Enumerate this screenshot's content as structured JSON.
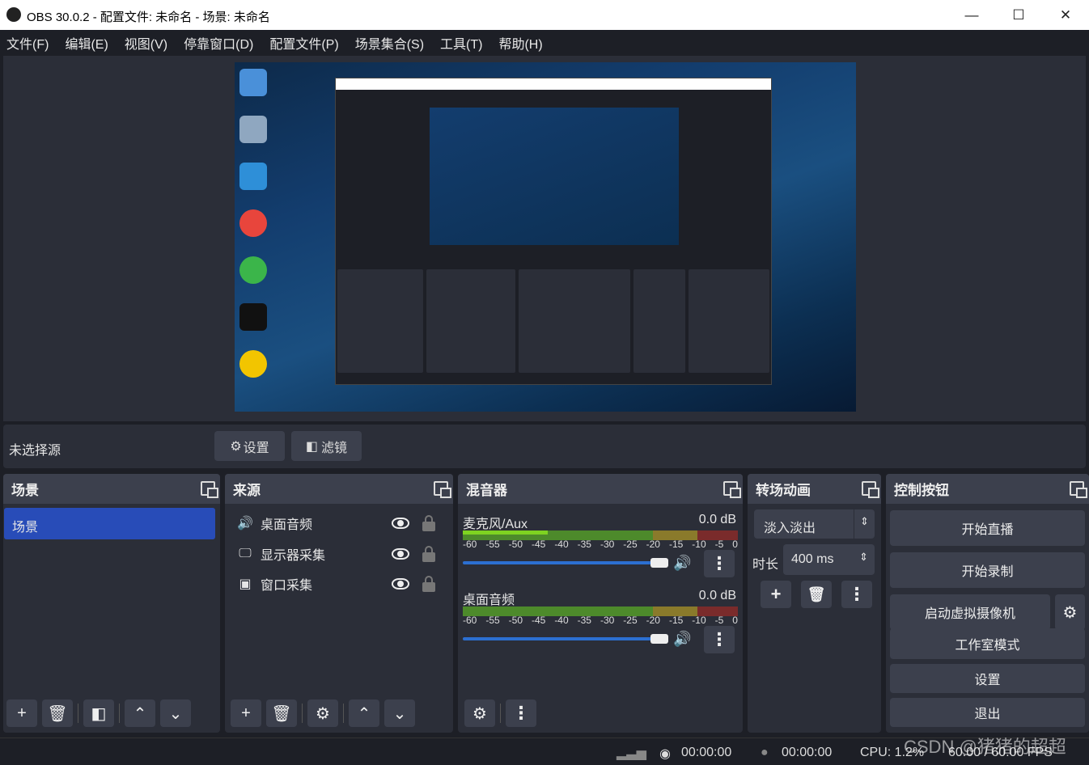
{
  "window": {
    "title": "OBS 30.0.2 - 配置文件: 未命名 - 场景: 未命名",
    "minimize": "—",
    "maximize": "☐",
    "close": "✕"
  },
  "menu": [
    "文件(F)",
    "编辑(E)",
    "视图(V)",
    "停靠窗口(D)",
    "配置文件(P)",
    "场景集合(S)",
    "工具(T)",
    "帮助(H)"
  ],
  "source_bar": {
    "label": "未选择源",
    "settings": "设置",
    "filters": "滤镜"
  },
  "scenes": {
    "title": "场景",
    "items": [
      "场景"
    ]
  },
  "sources": {
    "title": "来源",
    "items": [
      {
        "name": "桌面音频",
        "icon": "speaker-icon"
      },
      {
        "name": "显示器采集",
        "icon": "monitor-icon"
      },
      {
        "name": "窗口采集",
        "icon": "window-icon"
      }
    ]
  },
  "mixer": {
    "title": "混音器",
    "channels": [
      {
        "name": "麦克风/Aux",
        "db": "0.0 dB"
      },
      {
        "name": "桌面音频",
        "db": "0.0 dB"
      }
    ],
    "ticks": [
      "-60",
      "-55",
      "-50",
      "-45",
      "-40",
      "-35",
      "-30",
      "-25",
      "-20",
      "-15",
      "-10",
      "-5",
      "0"
    ]
  },
  "transitions": {
    "title": "转场动画",
    "selected": "淡入淡出",
    "duration_label": "时长",
    "duration_value": "400 ms"
  },
  "controls": {
    "title": "控制按钮",
    "buttons": [
      "开始直播",
      "开始录制",
      "启动虚拟摄像机",
      "工作室模式",
      "设置",
      "退出"
    ]
  },
  "status": {
    "stream_time": "00:00:00",
    "record_time": "00:00:00",
    "cpu": "CPU: 1.2%",
    "fps": "60.00 / 60.00 FPS"
  },
  "watermark": "CSDN @猪猪的超超",
  "colors": {
    "accent": "#284cb8",
    "panel": "#2b2e38",
    "background": "#1d1f26"
  }
}
